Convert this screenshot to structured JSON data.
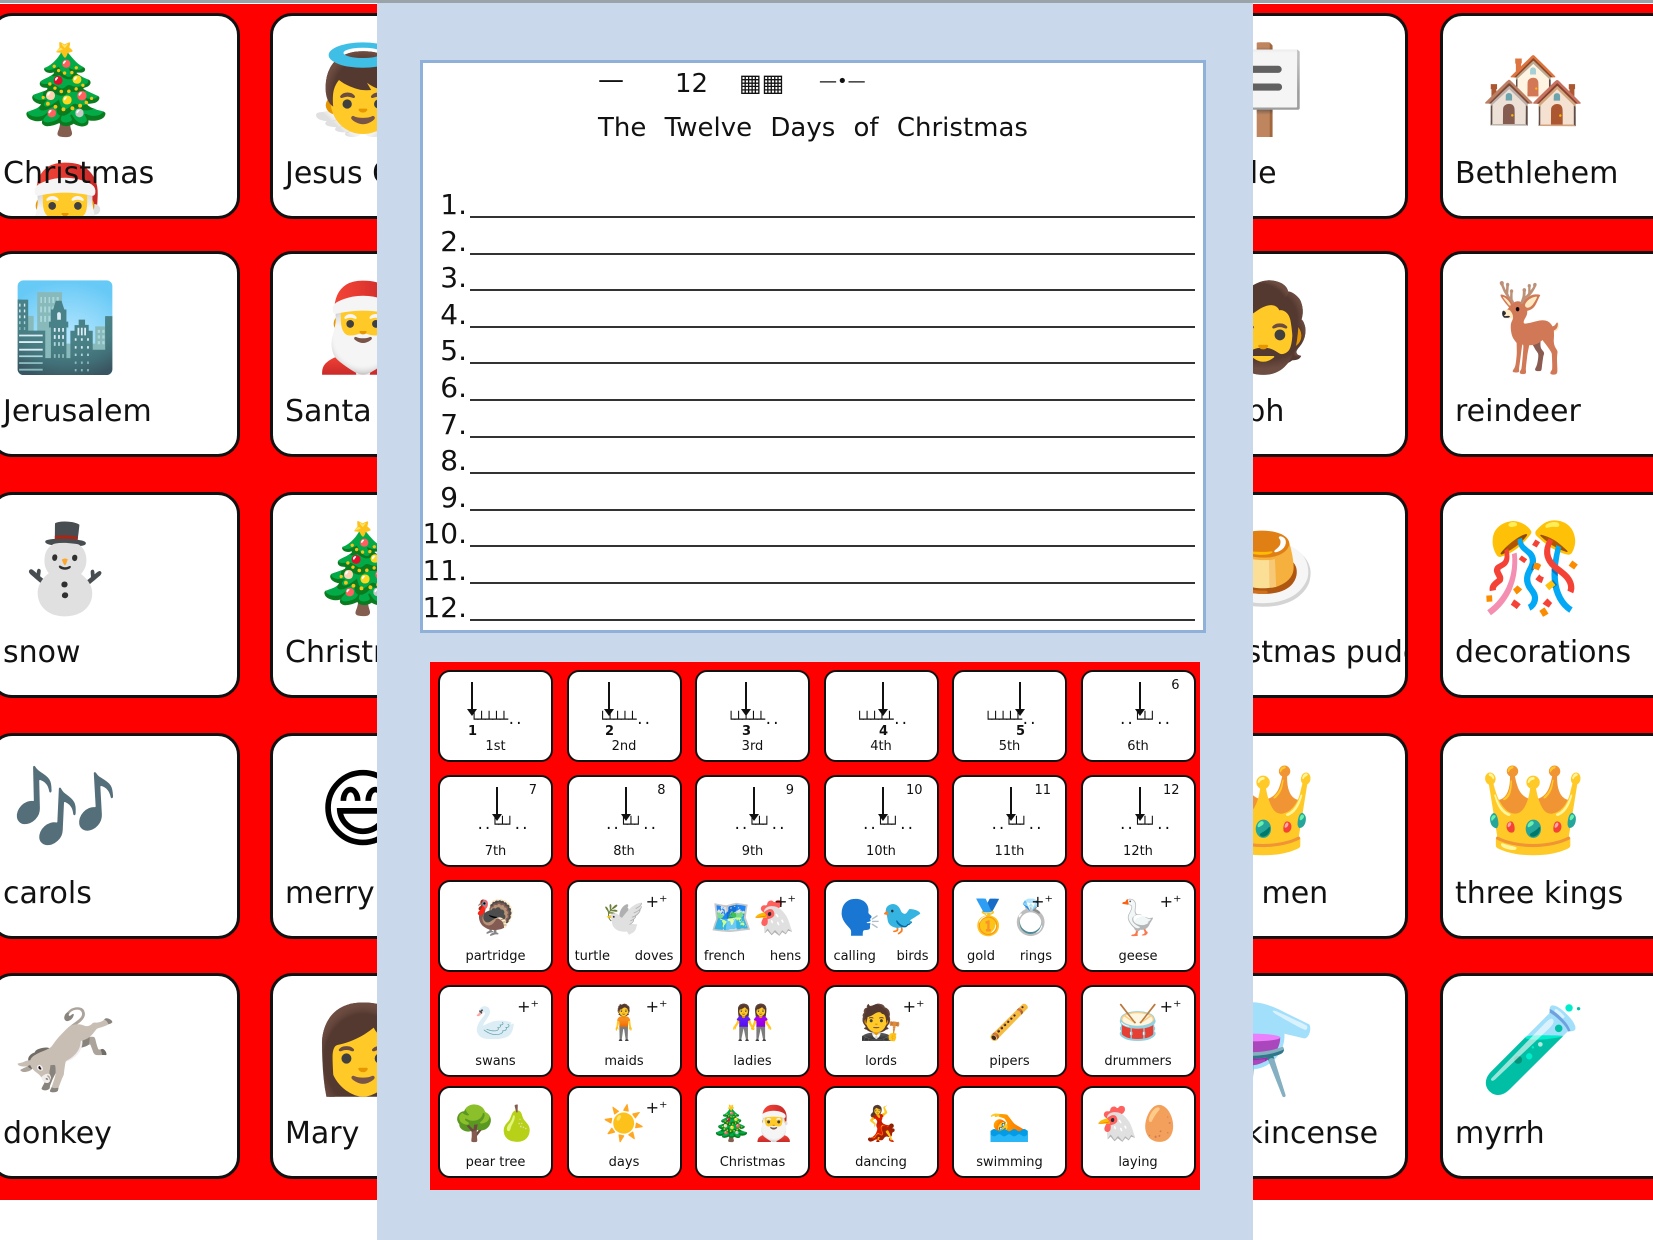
{
  "background_board": {
    "cells": [
      {
        "label": "Christmas",
        "icon": "christmas-tree-santa-icon",
        "glyph": "🎄🎅"
      },
      {
        "label": "Jesus Christ",
        "icon": "jesus-icon",
        "glyph": "👼"
      },
      {
        "label": "stable",
        "icon": "stable-sign-icon",
        "glyph": "🪧"
      },
      {
        "label": "",
        "icon": "",
        "glyph": ""
      },
      {
        "label": "Bethlehem",
        "icon": "bethlehem-town-icon",
        "glyph": "🏘️"
      },
      {
        "label": "Jerusalem",
        "icon": "jerusalem-city-icon",
        "glyph": "🏙️"
      },
      {
        "label": "Santa Claus",
        "icon": "santa-icon",
        "glyph": "🎅"
      },
      {
        "label": "Joseph",
        "icon": "joseph-icon",
        "glyph": "🧔"
      },
      {
        "label": "",
        "icon": "",
        "glyph": ""
      },
      {
        "label": "reindeer",
        "icon": "reindeer-icon",
        "glyph": "🦌"
      },
      {
        "label": "snow",
        "icon": "snowman-icon",
        "glyph": "⛄"
      },
      {
        "label": "Christmas tree",
        "icon": "christmas-tree-icon",
        "glyph": "🎄"
      },
      {
        "label": "Christmas pudding",
        "icon": "christmas-pudding-icon",
        "glyph": "🍮"
      },
      {
        "label": "",
        "icon": "",
        "glyph": ""
      },
      {
        "label": "decorations",
        "icon": "decorations-icon",
        "glyph": "🎊"
      },
      {
        "label": "carols",
        "icon": "carol-singers-icon",
        "glyph": "🎶"
      },
      {
        "label": "merry",
        "icon": "smiling-face-icon",
        "glyph": "😄"
      },
      {
        "label": "wise men",
        "icon": "wise-men-icon",
        "glyph": "👑"
      },
      {
        "label": "",
        "icon": "",
        "glyph": ""
      },
      {
        "label": "three kings",
        "icon": "three-kings-icon",
        "glyph": "👑"
      },
      {
        "label": "donkey",
        "icon": "donkey-icon",
        "glyph": "🫏"
      },
      {
        "label": "Mary",
        "icon": "mary-icon",
        "glyph": "👩"
      },
      {
        "label": "frankincense",
        "icon": "frankincense-bottle-icon",
        "glyph": "⚗️"
      },
      {
        "label": "",
        "icon": "",
        "glyph": ""
      },
      {
        "label": "myrrh",
        "icon": "myrrh-bottle-icon",
        "glyph": "🧪"
      }
    ]
  },
  "worksheet": {
    "symbol_header": {
      "the_symbol": "—",
      "number": "12",
      "days_symbol": "▦▦",
      "of_symbol": "—•—"
    },
    "title": "The Twelve Days of Christmas",
    "lines": [
      "1.",
      "2.",
      "3.",
      "4.",
      "5.",
      "6.",
      "7.",
      "8.",
      "9.",
      "10.",
      "11.",
      "12."
    ]
  },
  "word_bank": {
    "ordinals": [
      {
        "label": "1st",
        "n": "1"
      },
      {
        "label": "2nd",
        "n": "2"
      },
      {
        "label": "3rd",
        "n": "3"
      },
      {
        "label": "4th",
        "n": "4"
      },
      {
        "label": "5th",
        "n": "5"
      },
      {
        "label": "6th",
        "n": "6"
      },
      {
        "label": "7th",
        "n": "7"
      },
      {
        "label": "8th",
        "n": "8"
      },
      {
        "label": "9th",
        "n": "9"
      },
      {
        "label": "10th",
        "n": "10"
      },
      {
        "label": "11th",
        "n": "11"
      },
      {
        "label": "12th",
        "n": "12"
      }
    ],
    "words": [
      {
        "label": "partridge",
        "icon": "partridge-icon",
        "glyph": "🦃",
        "plural": false
      },
      {
        "label": "turtle      doves",
        "icon": "turtle-doves-icon",
        "glyph": "🕊️",
        "plural": true
      },
      {
        "label": "french      hens",
        "icon": "french-hens-icon",
        "glyph": "🗺️🐔",
        "plural": true
      },
      {
        "label": "calling     birds",
        "icon": "calling-birds-icon",
        "glyph": "🗣️🐦",
        "plural": false
      },
      {
        "label": "gold      rings",
        "icon": "gold-rings-icon",
        "glyph": "🥇💍",
        "plural": true
      },
      {
        "label": "geese",
        "icon": "geese-icon",
        "glyph": "🪿",
        "plural": true
      },
      {
        "label": "swans",
        "icon": "swan-icon",
        "glyph": "🦢",
        "plural": true
      },
      {
        "label": "maids",
        "icon": "maid-icon",
        "glyph": "🧍",
        "plural": true
      },
      {
        "label": "ladies",
        "icon": "ladies-icon",
        "glyph": "👭",
        "plural": false
      },
      {
        "label": "lords",
        "icon": "lords-icon",
        "glyph": "🧑‍⚖️",
        "plural": true
      },
      {
        "label": "pipers",
        "icon": "piper-icon",
        "glyph": "🪈",
        "plural": false
      },
      {
        "label": "drummers",
        "icon": "drummer-icon",
        "glyph": "🥁",
        "plural": true
      },
      {
        "label": "pear tree",
        "icon": "pear-tree-icon",
        "glyph": "🌳🍐",
        "plural": false
      },
      {
        "label": "days",
        "icon": "days-calendar-icon",
        "glyph": "☀️",
        "plural": true
      },
      {
        "label": "Christmas",
        "icon": "christmas-tree-santa-icon",
        "glyph": "🎄🎅",
        "plural": false
      },
      {
        "label": "dancing",
        "icon": "dancing-icon",
        "glyph": "💃",
        "plural": false
      },
      {
        "label": "swimming",
        "icon": "swimming-icon",
        "glyph": "🏊",
        "plural": false
      },
      {
        "label": "laying",
        "icon": "laying-hen-icon",
        "glyph": "🐔🥚",
        "plural": false
      }
    ],
    "plural_marker": "+⁺"
  },
  "colors": {
    "board_red": "#ff0000",
    "panel_blue": "#c9d8eb",
    "sheet_border": "#8fb0d8"
  }
}
